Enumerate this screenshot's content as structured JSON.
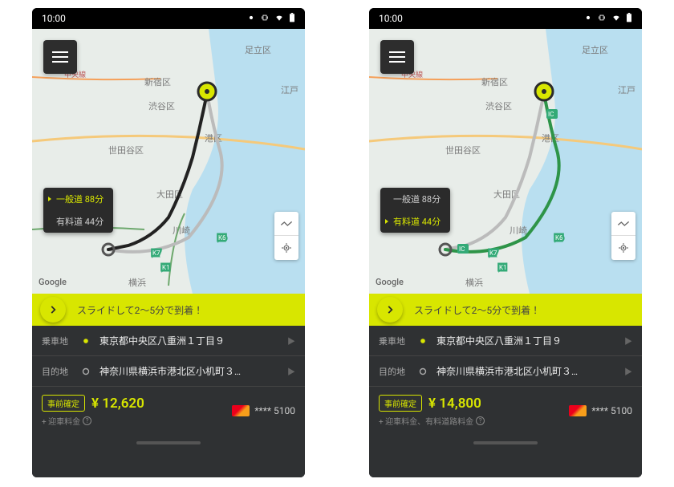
{
  "statusbar": {
    "time": "10:00"
  },
  "routes": {
    "general": {
      "label": "一般道 88分"
    },
    "toll": {
      "label": "有料道 44分"
    }
  },
  "map": {
    "attribution": "Google",
    "label_yokohama": "横浜",
    "label_shinjuku": "新宿区",
    "label_shibuya": "渋谷区",
    "label_minato": "港区",
    "label_setagaya": "世田谷区",
    "label_ota": "大田区",
    "label_kawasaki": "川崎",
    "label_adachi": "足立区",
    "label_edogawa": "江戸",
    "label_chuo": "中央線"
  },
  "slide": {
    "text": "スライドして2〜5分で到着！"
  },
  "pickup": {
    "label": "乗車地",
    "value": "東京都中央区八重洲１丁目９"
  },
  "dest": {
    "label": "目的地",
    "value": "神奈川県横浜市港北区小机町３…"
  },
  "payment": {
    "badge": "事前確定",
    "masked": "**** 5100"
  },
  "left": {
    "price": "¥ 12,620",
    "note": "+ 迎車料金"
  },
  "right": {
    "price": "¥ 14,800",
    "note": "+ 迎車料金、有料道路料金"
  }
}
